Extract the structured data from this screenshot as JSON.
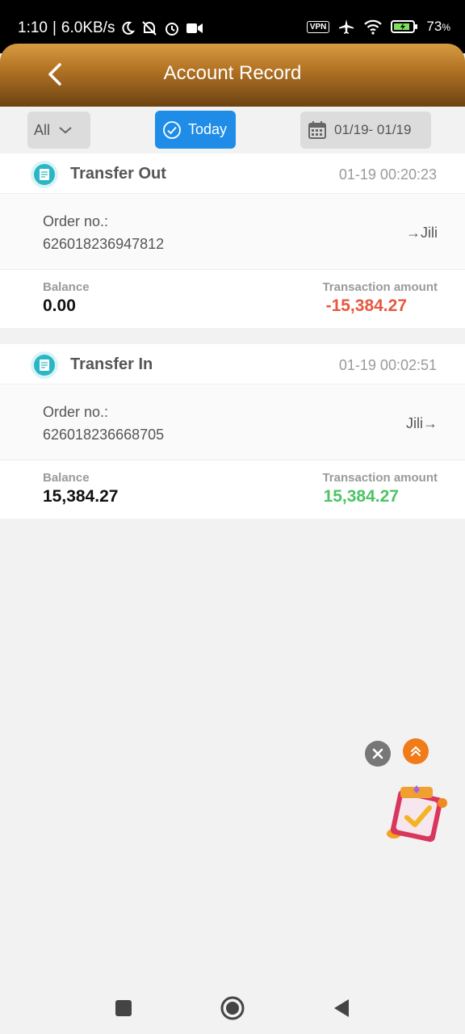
{
  "status_bar": {
    "time": "1:10",
    "speed": "6.0KB/s",
    "vpn": "VPN",
    "battery": "73",
    "battery_unit": "%",
    "icons": [
      "moon-icon",
      "bell-off-icon",
      "alarm-icon",
      "video-icon",
      "airplane-icon",
      "wifi-icon",
      "battery-icon"
    ]
  },
  "header": {
    "title": "Account Record"
  },
  "filters": {
    "type_label": "All",
    "today_label": "Today",
    "date_range": "01/19- 01/19"
  },
  "records": [
    {
      "type": "Transfer Out",
      "time": "01-19 00:20:23",
      "order_label": "Order no.:",
      "order_no": "626018236947812",
      "destination": "→Jili",
      "balance_label": "Balance",
      "balance": "0.00",
      "amount_label": "Transaction amount",
      "amount": "-15,384.27"
    },
    {
      "type": "Transfer In",
      "time": "01-19 00:02:51",
      "order_label": "Order no.:",
      "order_no": "626018236668705",
      "destination": "Jili→",
      "balance_label": "Balance",
      "balance": "15,384.27",
      "amount_label": "Transaction amount",
      "amount": "15,384.27"
    }
  ],
  "colors": {
    "accent_blue": "#1f8de8",
    "header_gold": "#b47424",
    "negative": "#e8573e",
    "positive": "#4dc466"
  }
}
